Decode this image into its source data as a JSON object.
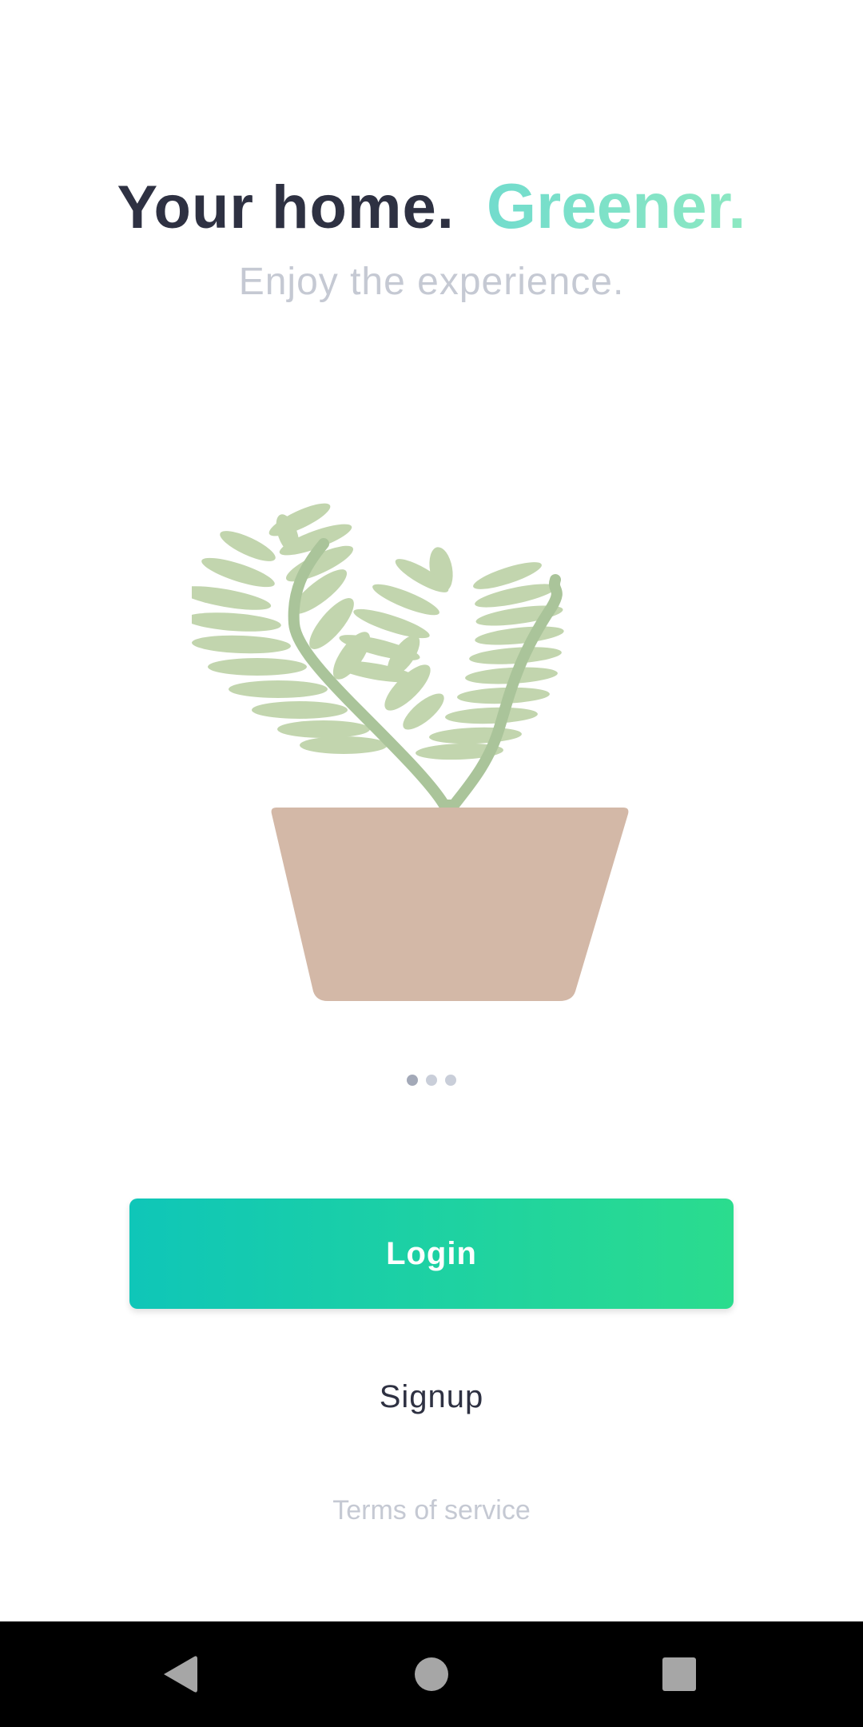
{
  "header": {
    "headline_part1": "Your home.",
    "headline_part2": "Greener.",
    "subtitle": "Enjoy the experience."
  },
  "illustration": {
    "icon": "potted-plant-illustration",
    "colors": {
      "leaf": "#c2d5ae",
      "stem": "#aac49a",
      "pot": "#d3b8a7"
    }
  },
  "pager": {
    "total": 3,
    "active_index": 0
  },
  "actions": {
    "login_label": "Login",
    "signup_label": "Signup",
    "terms_label": "Terms of service"
  },
  "system_nav": {
    "back_icon": "back-triangle-icon",
    "home_icon": "home-circle-icon",
    "recents_icon": "recents-square-icon"
  },
  "colors": {
    "text_dark": "#2e3142",
    "text_muted": "#c5c9d3",
    "accent_start": "#0fc6b8",
    "accent_end": "#2bdc8e"
  }
}
